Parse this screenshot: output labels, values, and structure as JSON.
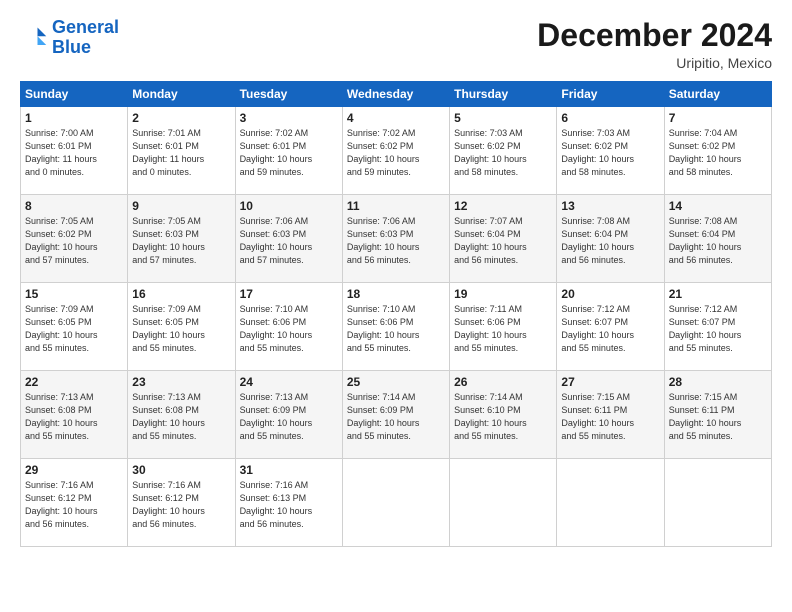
{
  "header": {
    "logo_line1": "General",
    "logo_line2": "Blue",
    "month_title": "December 2024",
    "subtitle": "Uripitio, Mexico"
  },
  "days_of_week": [
    "Sunday",
    "Monday",
    "Tuesday",
    "Wednesday",
    "Thursday",
    "Friday",
    "Saturday"
  ],
  "weeks": [
    [
      {
        "day": "1",
        "info": "Sunrise: 7:00 AM\nSunset: 6:01 PM\nDaylight: 11 hours\nand 0 minutes."
      },
      {
        "day": "2",
        "info": "Sunrise: 7:01 AM\nSunset: 6:01 PM\nDaylight: 11 hours\nand 0 minutes."
      },
      {
        "day": "3",
        "info": "Sunrise: 7:02 AM\nSunset: 6:01 PM\nDaylight: 10 hours\nand 59 minutes."
      },
      {
        "day": "4",
        "info": "Sunrise: 7:02 AM\nSunset: 6:02 PM\nDaylight: 10 hours\nand 59 minutes."
      },
      {
        "day": "5",
        "info": "Sunrise: 7:03 AM\nSunset: 6:02 PM\nDaylight: 10 hours\nand 58 minutes."
      },
      {
        "day": "6",
        "info": "Sunrise: 7:03 AM\nSunset: 6:02 PM\nDaylight: 10 hours\nand 58 minutes."
      },
      {
        "day": "7",
        "info": "Sunrise: 7:04 AM\nSunset: 6:02 PM\nDaylight: 10 hours\nand 58 minutes."
      }
    ],
    [
      {
        "day": "8",
        "info": "Sunrise: 7:05 AM\nSunset: 6:02 PM\nDaylight: 10 hours\nand 57 minutes."
      },
      {
        "day": "9",
        "info": "Sunrise: 7:05 AM\nSunset: 6:03 PM\nDaylight: 10 hours\nand 57 minutes."
      },
      {
        "day": "10",
        "info": "Sunrise: 7:06 AM\nSunset: 6:03 PM\nDaylight: 10 hours\nand 57 minutes."
      },
      {
        "day": "11",
        "info": "Sunrise: 7:06 AM\nSunset: 6:03 PM\nDaylight: 10 hours\nand 56 minutes."
      },
      {
        "day": "12",
        "info": "Sunrise: 7:07 AM\nSunset: 6:04 PM\nDaylight: 10 hours\nand 56 minutes."
      },
      {
        "day": "13",
        "info": "Sunrise: 7:08 AM\nSunset: 6:04 PM\nDaylight: 10 hours\nand 56 minutes."
      },
      {
        "day": "14",
        "info": "Sunrise: 7:08 AM\nSunset: 6:04 PM\nDaylight: 10 hours\nand 56 minutes."
      }
    ],
    [
      {
        "day": "15",
        "info": "Sunrise: 7:09 AM\nSunset: 6:05 PM\nDaylight: 10 hours\nand 55 minutes."
      },
      {
        "day": "16",
        "info": "Sunrise: 7:09 AM\nSunset: 6:05 PM\nDaylight: 10 hours\nand 55 minutes."
      },
      {
        "day": "17",
        "info": "Sunrise: 7:10 AM\nSunset: 6:06 PM\nDaylight: 10 hours\nand 55 minutes."
      },
      {
        "day": "18",
        "info": "Sunrise: 7:10 AM\nSunset: 6:06 PM\nDaylight: 10 hours\nand 55 minutes."
      },
      {
        "day": "19",
        "info": "Sunrise: 7:11 AM\nSunset: 6:06 PM\nDaylight: 10 hours\nand 55 minutes."
      },
      {
        "day": "20",
        "info": "Sunrise: 7:12 AM\nSunset: 6:07 PM\nDaylight: 10 hours\nand 55 minutes."
      },
      {
        "day": "21",
        "info": "Sunrise: 7:12 AM\nSunset: 6:07 PM\nDaylight: 10 hours\nand 55 minutes."
      }
    ],
    [
      {
        "day": "22",
        "info": "Sunrise: 7:13 AM\nSunset: 6:08 PM\nDaylight: 10 hours\nand 55 minutes."
      },
      {
        "day": "23",
        "info": "Sunrise: 7:13 AM\nSunset: 6:08 PM\nDaylight: 10 hours\nand 55 minutes."
      },
      {
        "day": "24",
        "info": "Sunrise: 7:13 AM\nSunset: 6:09 PM\nDaylight: 10 hours\nand 55 minutes."
      },
      {
        "day": "25",
        "info": "Sunrise: 7:14 AM\nSunset: 6:09 PM\nDaylight: 10 hours\nand 55 minutes."
      },
      {
        "day": "26",
        "info": "Sunrise: 7:14 AM\nSunset: 6:10 PM\nDaylight: 10 hours\nand 55 minutes."
      },
      {
        "day": "27",
        "info": "Sunrise: 7:15 AM\nSunset: 6:11 PM\nDaylight: 10 hours\nand 55 minutes."
      },
      {
        "day": "28",
        "info": "Sunrise: 7:15 AM\nSunset: 6:11 PM\nDaylight: 10 hours\nand 55 minutes."
      }
    ],
    [
      {
        "day": "29",
        "info": "Sunrise: 7:16 AM\nSunset: 6:12 PM\nDaylight: 10 hours\nand 56 minutes."
      },
      {
        "day": "30",
        "info": "Sunrise: 7:16 AM\nSunset: 6:12 PM\nDaylight: 10 hours\nand 56 minutes."
      },
      {
        "day": "31",
        "info": "Sunrise: 7:16 AM\nSunset: 6:13 PM\nDaylight: 10 hours\nand 56 minutes."
      },
      null,
      null,
      null,
      null
    ]
  ]
}
